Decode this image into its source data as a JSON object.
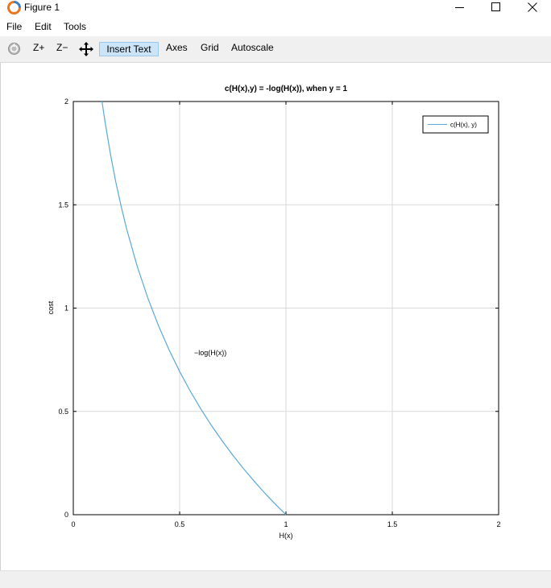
{
  "window": {
    "title": "Figure 1",
    "icons": {
      "app": "octave-icon",
      "minimize": "minimize-icon",
      "maximize": "maximize-icon",
      "close": "close-icon"
    }
  },
  "menu": {
    "file": "File",
    "edit": "Edit",
    "tools": "Tools"
  },
  "toolbar": {
    "rotate_icon": "rotate-icon",
    "zoom_in": "Z+",
    "zoom_out": "Z−",
    "pan_icon": "pan-icon",
    "insert_text": "Insert Text",
    "axes": "Axes",
    "grid": "Grid",
    "autoscale": "Autoscale"
  },
  "chart_data": {
    "type": "line",
    "title": "c(H(x),y) = -log(H(x)), when y = 1",
    "xlabel": "H(x)",
    "ylabel": "cost",
    "xlim": [
      0,
      2
    ],
    "ylim": [
      0,
      2
    ],
    "xticks": [
      "0",
      "0.5",
      "1",
      "1.5",
      "2"
    ],
    "yticks": [
      "0",
      "0.5",
      "1",
      "1.5",
      "2"
    ],
    "grid": true,
    "legend_position": "top-right",
    "annotation": "−log(H(x))",
    "series": [
      {
        "name": "c(H(x), y)",
        "color": "#5aa9da",
        "x": [
          0.135,
          0.15,
          0.175,
          0.2,
          0.225,
          0.25,
          0.3,
          0.35,
          0.4,
          0.45,
          0.5,
          0.55,
          0.6,
          0.65,
          0.7,
          0.75,
          0.8,
          0.85,
          0.9,
          0.95,
          1.0
        ],
        "y": [
          2.0,
          1.897,
          1.743,
          1.609,
          1.492,
          1.386,
          1.204,
          1.05,
          0.916,
          0.799,
          0.693,
          0.598,
          0.511,
          0.431,
          0.357,
          0.288,
          0.223,
          0.163,
          0.105,
          0.051,
          0.0
        ]
      }
    ]
  }
}
